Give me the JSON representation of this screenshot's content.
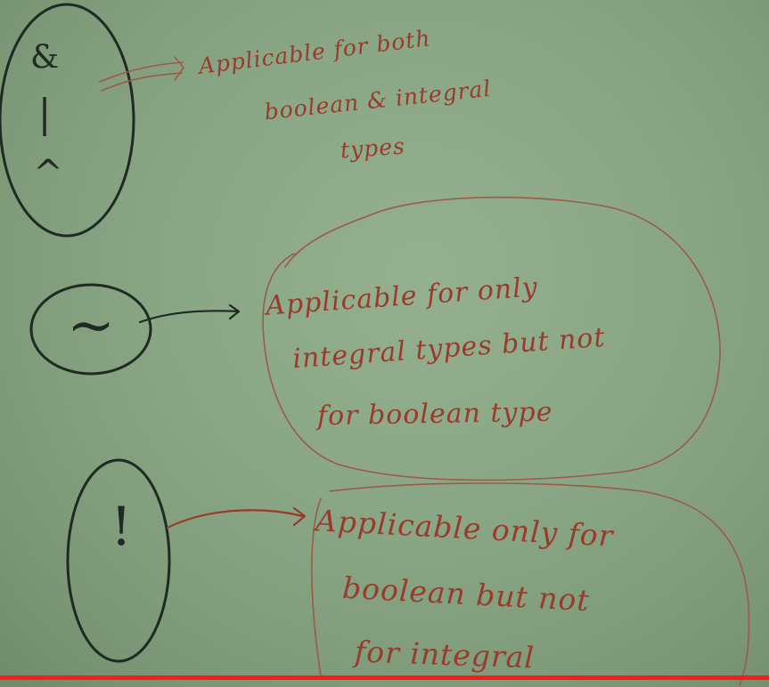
{
  "group_ops": {
    "symbols": [
      "&",
      "|",
      "^"
    ],
    "note_lines": [
      "Applicable for both",
      "boolean & integral",
      "types"
    ]
  },
  "tilde_op": {
    "symbol": "~",
    "note_lines": [
      "Applicable for only",
      "integral types but not",
      "for boolean type"
    ]
  },
  "not_op": {
    "symbol": "!",
    "note_lines": [
      "Applicable only for",
      "boolean but not",
      "for integral"
    ]
  },
  "video": {
    "progress_fraction": 1.0,
    "progress_color": "#ff1a1a"
  }
}
